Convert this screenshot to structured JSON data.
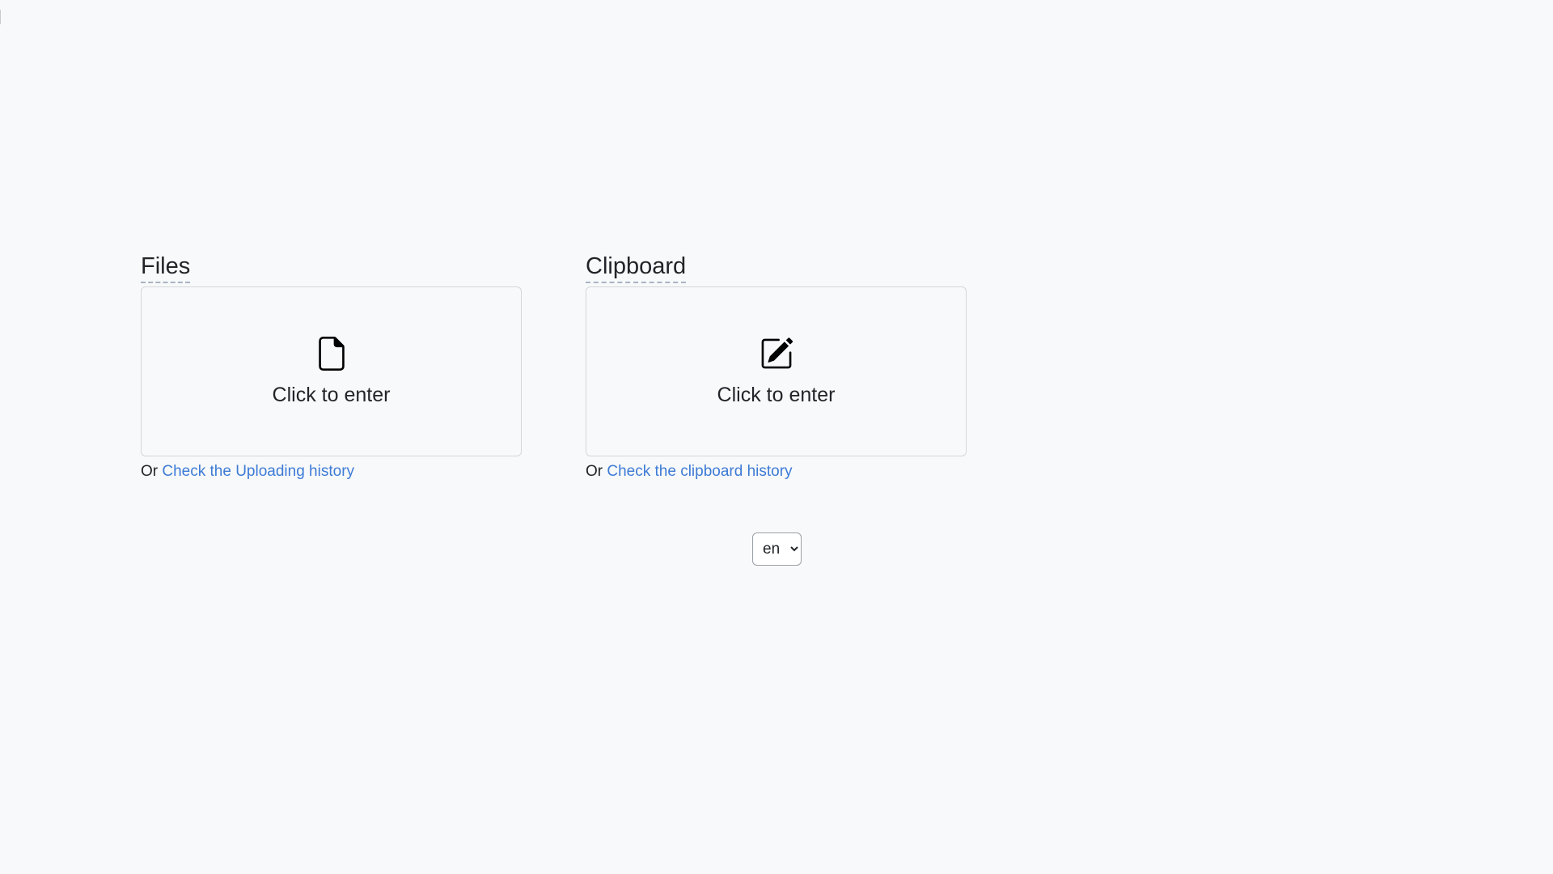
{
  "files": {
    "title": "Files",
    "card_label": "Click to enter",
    "icon": "file-icon",
    "history_prefix": "Or",
    "history_link": "Check the Uploading history"
  },
  "clipboard": {
    "title": "Clipboard",
    "card_label": "Click to enter",
    "icon": "pencil-square-icon",
    "history_prefix": "Or",
    "history_link": "Check the clipboard history"
  },
  "language": {
    "selected": "en",
    "options": [
      "en"
    ]
  },
  "colors": {
    "background": "#f8f9fa",
    "link": "#3d7bd6",
    "border": "#d3d7dc",
    "title_underline": "#a9b4c2"
  }
}
